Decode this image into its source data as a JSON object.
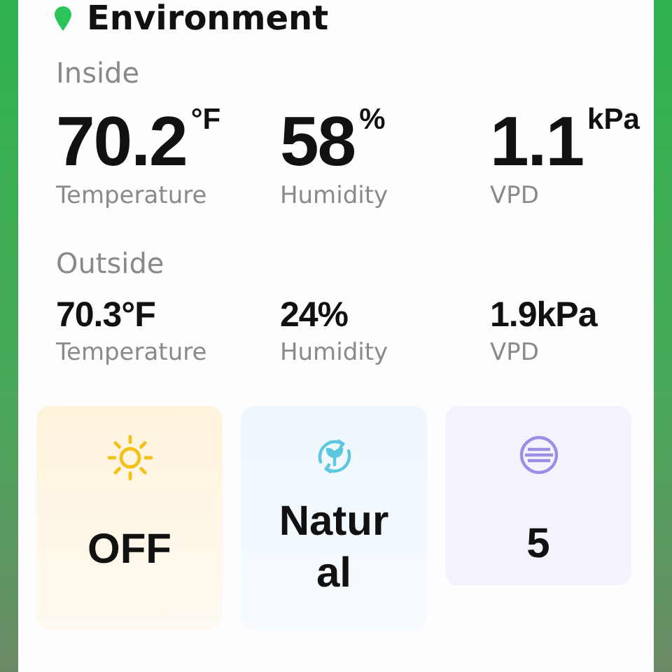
{
  "header": {
    "title": "Environment"
  },
  "inside": {
    "label": "Inside",
    "readings": [
      {
        "value": "70.2",
        "unit": "°F",
        "label": "Temperature"
      },
      {
        "value": "58",
        "unit": "%",
        "label": "Humidity"
      },
      {
        "value": "1.1",
        "unit": "kPa",
        "label": "VPD"
      }
    ]
  },
  "outside": {
    "label": "Outside",
    "readings": [
      {
        "value": "70.3°F",
        "label": "Temperature"
      },
      {
        "value": "24%",
        "label": "Humidity"
      },
      {
        "value": "1.9kPa",
        "label": "VPD"
      }
    ]
  },
  "tiles": [
    {
      "kind": "light",
      "value": "OFF"
    },
    {
      "kind": "mode",
      "value": "Natural"
    },
    {
      "kind": "level",
      "value": "5"
    }
  ]
}
